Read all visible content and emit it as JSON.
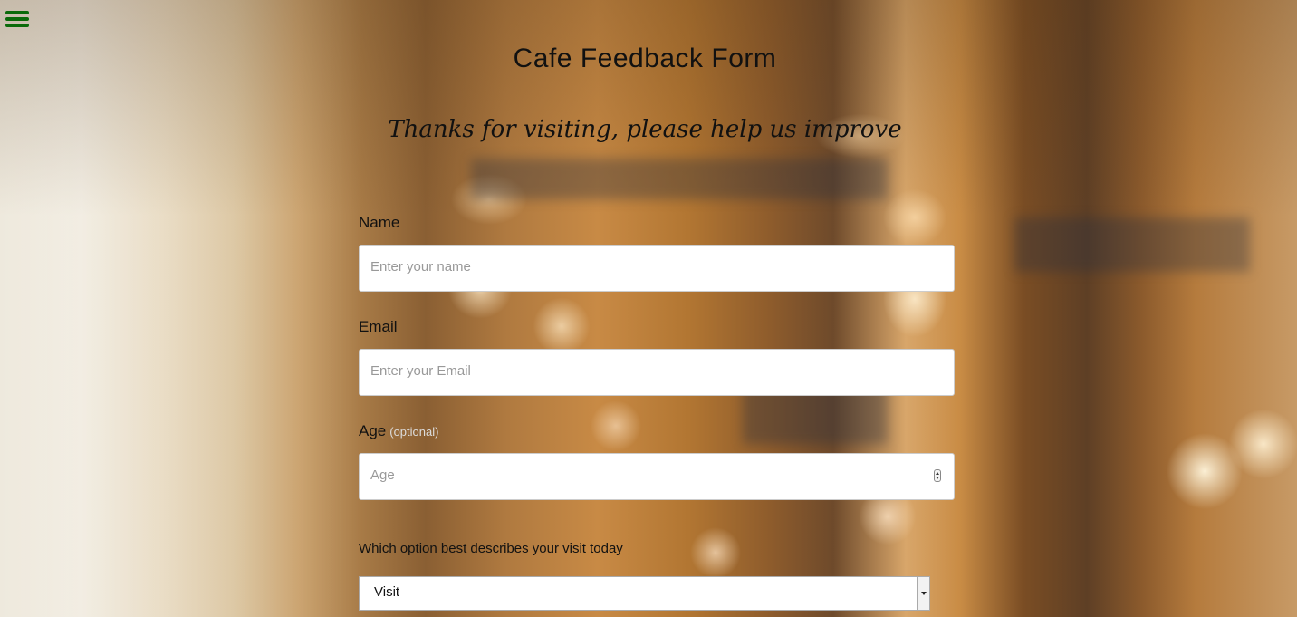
{
  "header": {
    "title": "Cafe Feedback Form",
    "subtitle": "Thanks for visiting, please help us improve"
  },
  "menu": {
    "icon": "hamburger-menu-icon"
  },
  "form": {
    "name": {
      "label": "Name",
      "placeholder": "Enter your name"
    },
    "email": {
      "label": "Email",
      "placeholder": "Enter your Email"
    },
    "age": {
      "label": "Age",
      "optional": "(optional)",
      "placeholder": "Age"
    },
    "visit": {
      "question": "Which option best describes your visit today",
      "selected": "Visit"
    }
  },
  "colors": {
    "menu_icon": "#0a6a0a",
    "optional_text": "#dddddd"
  }
}
